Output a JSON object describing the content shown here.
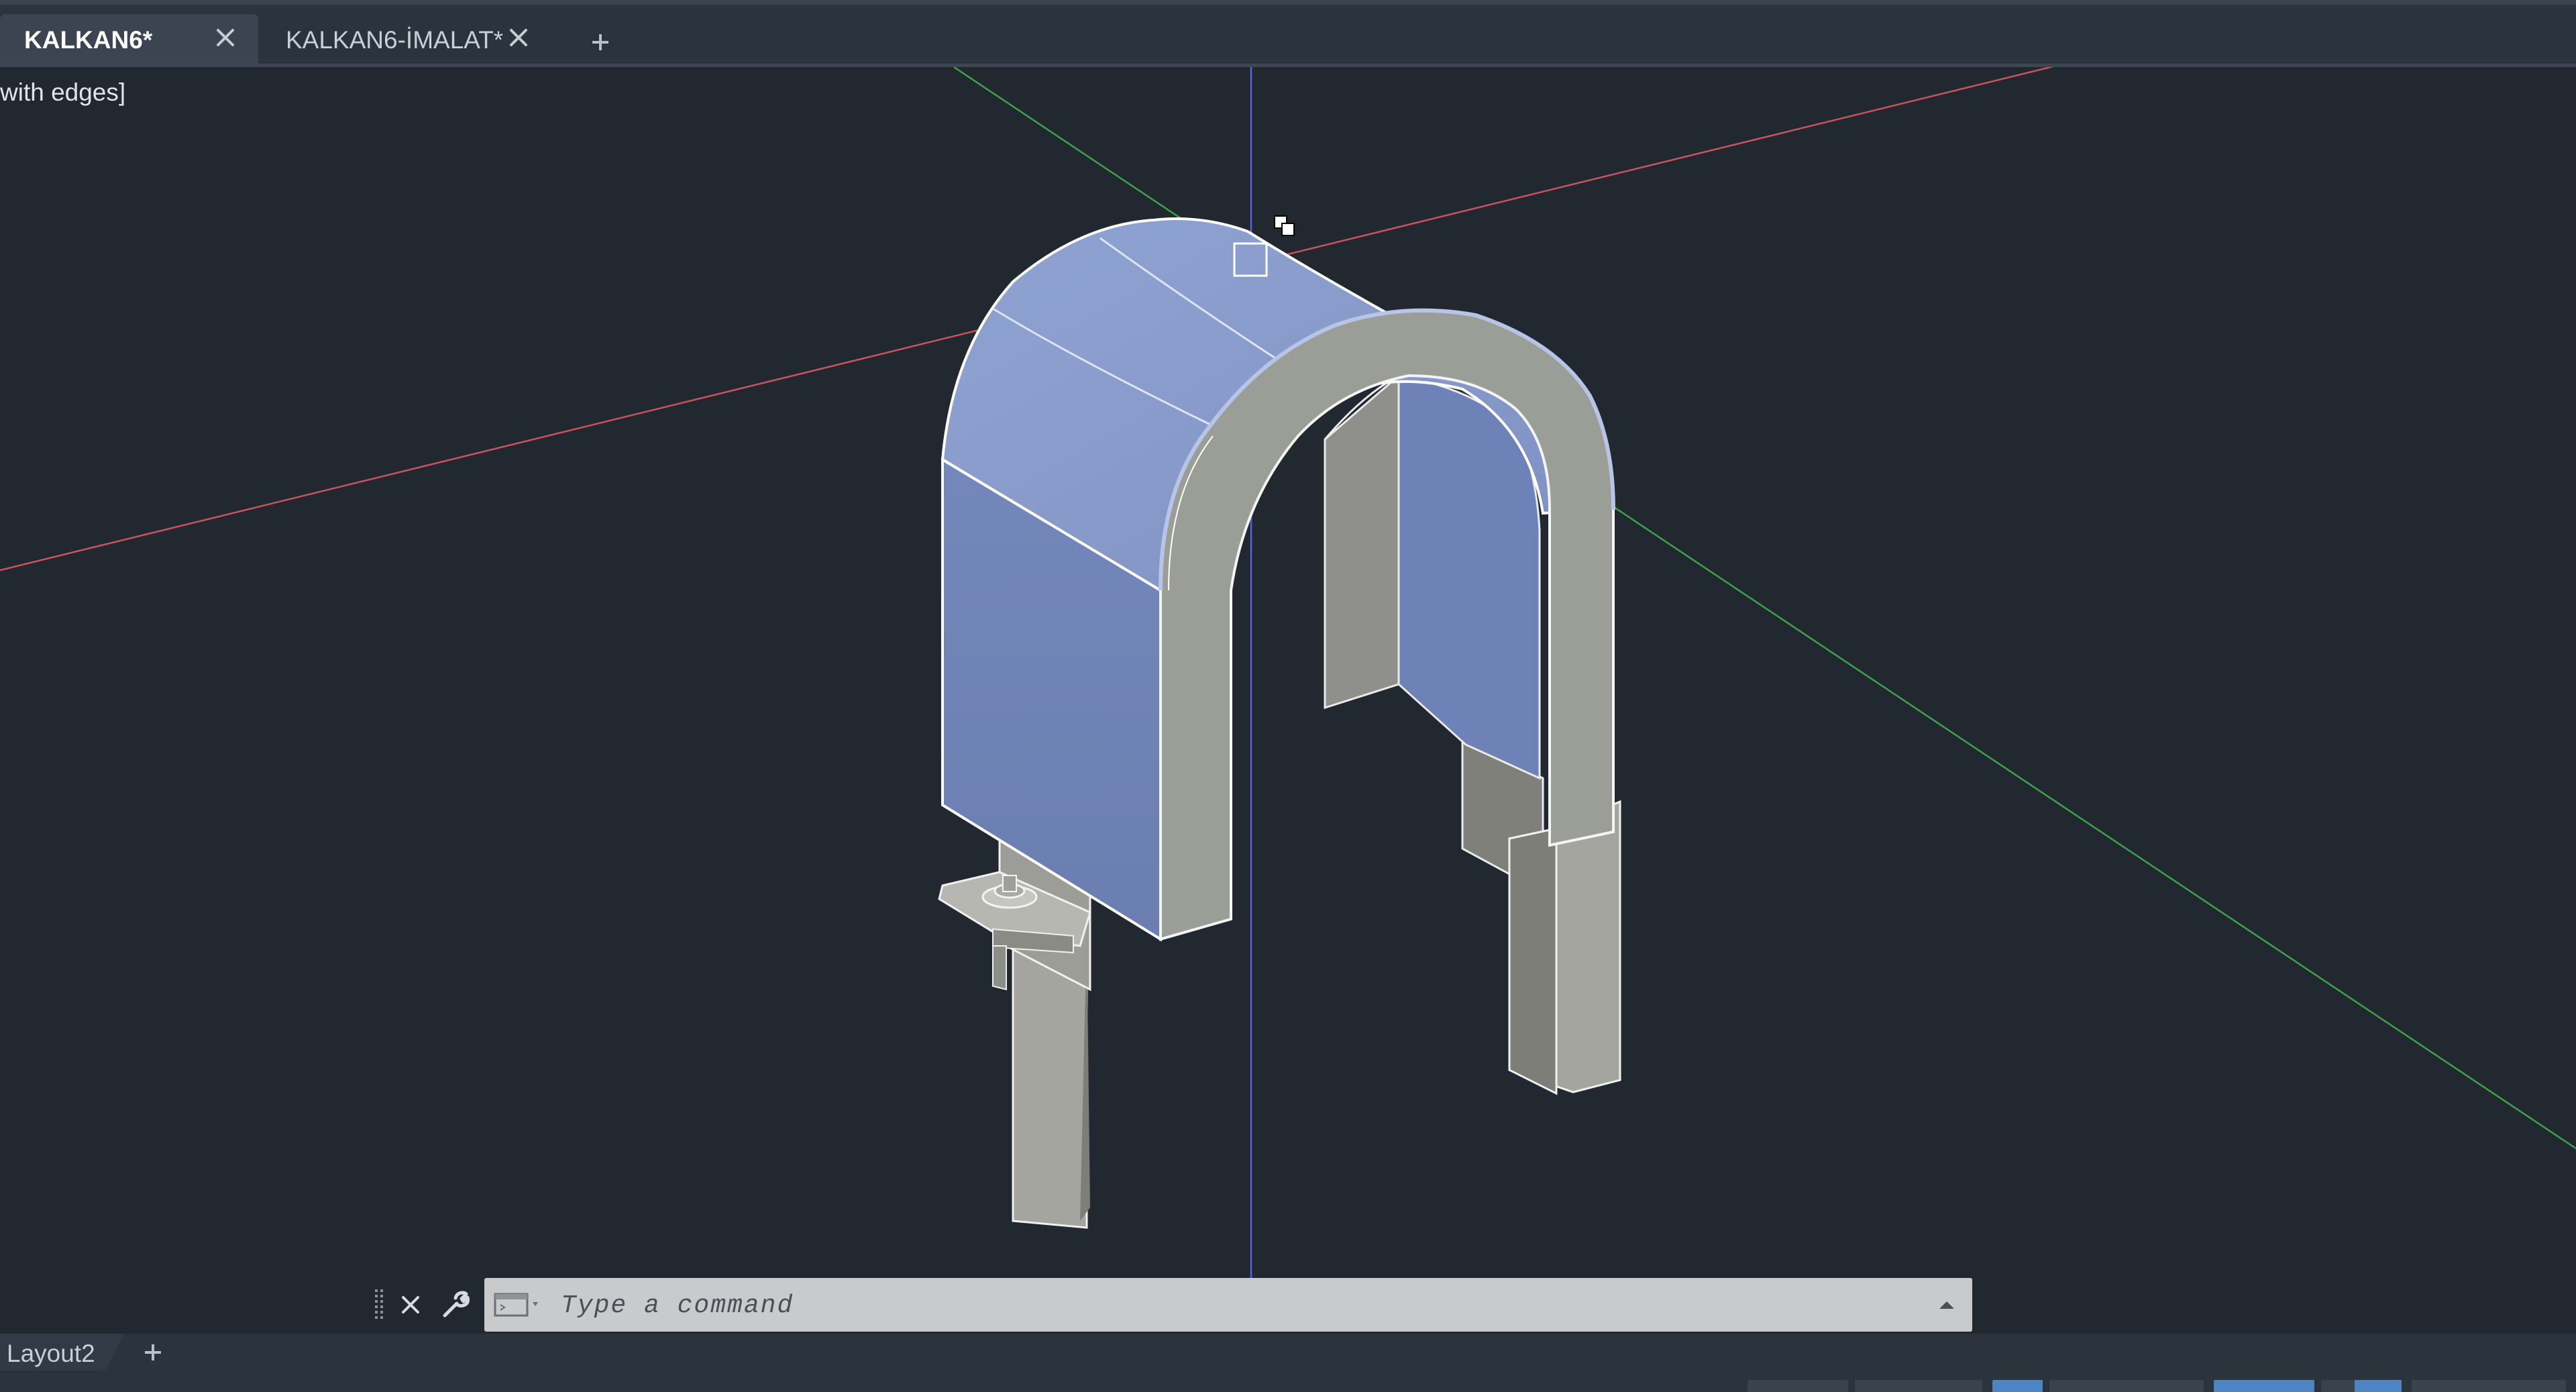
{
  "tabs": [
    {
      "label": "KALKAN6*",
      "active": true
    },
    {
      "label": "KALKAN6-İMALAT*",
      "active": false
    }
  ],
  "tab_close_glyph": "✕",
  "new_tab_glyph": "+",
  "viewport": {
    "visual_style_label": "with edges]",
    "axis_colors": {
      "x": "#c9545c",
      "y": "#3fa048",
      "z": "#5d63d6"
    }
  },
  "command_line": {
    "placeholder": "Type a command",
    "value": "",
    "icons": [
      "grip-icon",
      "close-icon",
      "wrench-icon",
      "command-history-icon",
      "expand-up-icon"
    ]
  },
  "layout_tabs": {
    "active_label": "Layout2",
    "add_glyph": "+"
  },
  "colors": {
    "background": "#212830",
    "tabbar": "#2b333d",
    "selected_surface": "#7f92c4",
    "solid_gray": "#9c9e98",
    "edge_white": "#ffffff"
  }
}
